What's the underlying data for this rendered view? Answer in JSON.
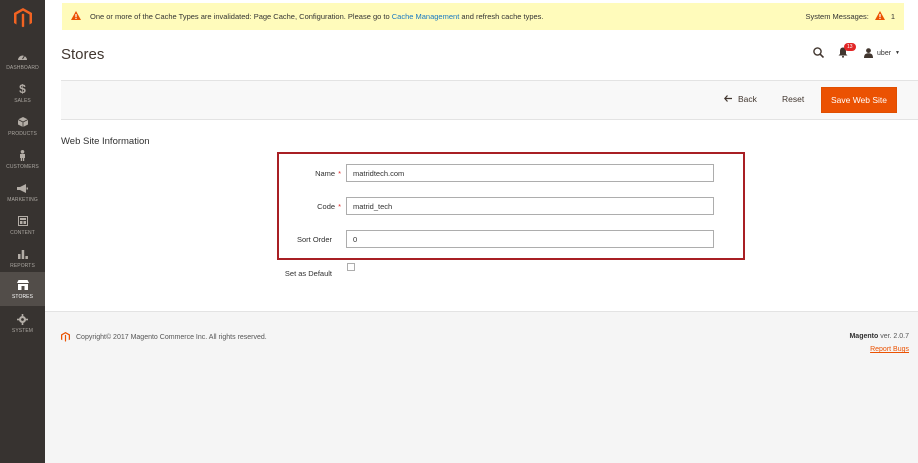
{
  "notice": {
    "text_before": "One or more of the Cache Types are invalidated: Page Cache, Configuration. Please go to",
    "link": "Cache Management",
    "text_after": "and refresh cache types.",
    "system_messages_label": "System Messages:",
    "system_messages_count": "1"
  },
  "sidebar": {
    "items": [
      {
        "label": "DASHBOARD",
        "icon": "dashboard-icon"
      },
      {
        "label": "SALES",
        "icon": "dollar-icon"
      },
      {
        "label": "PRODUCTS",
        "icon": "box-icon"
      },
      {
        "label": "CUSTOMERS",
        "icon": "person-icon"
      },
      {
        "label": "MARKETING",
        "icon": "megaphone-icon"
      },
      {
        "label": "CONTENT",
        "icon": "layout-icon"
      },
      {
        "label": "REPORTS",
        "icon": "bar-chart-icon"
      },
      {
        "label": "STORES",
        "icon": "store-icon"
      },
      {
        "label": "SYSTEM",
        "icon": "gear-icon"
      }
    ]
  },
  "header": {
    "title": "Stores",
    "notifications_count": "13",
    "user_name": "uber"
  },
  "actions": {
    "back": "Back",
    "reset": "Reset",
    "save": "Save Web Site"
  },
  "section": {
    "title": "Web Site Information"
  },
  "form": {
    "name_label": "Name",
    "name_value": "matridtech.com",
    "code_label": "Code",
    "code_value": "matrid_tech",
    "sort_order_label": "Sort Order",
    "sort_order_value": "0",
    "default_label": "Set as Default",
    "required_mark": "*"
  },
  "footer": {
    "copyright": "Copyright© 2017 Magento Commerce Inc. All rights reserved.",
    "brand": "Magento",
    "version": "ver. 2.0.7",
    "report_bugs": "Report Bugs"
  },
  "colors": {
    "sidebar_bg": "#373330",
    "accent": "#eb5202",
    "notice_bg": "#fffbbb",
    "highlight": "#a81f24"
  }
}
